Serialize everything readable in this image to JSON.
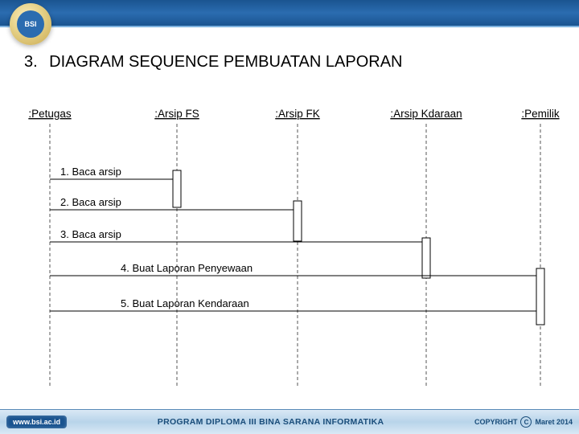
{
  "title_num": "3.",
  "title_text": "DIAGRAM SEQUENCE PEMBUATAN LAPORAN",
  "participants": {
    "p0": ":Petugas",
    "p1": ":Arsip FS",
    "p2": ":Arsip FK",
    "p3": ":Arsip Kdaraan",
    "p4": ":Pemilik"
  },
  "messages": {
    "m1": "1. Baca arsip",
    "m2": "2. Baca arsip",
    "m3": "3. Baca arsip",
    "m4": "4. Buat Laporan Penyewaan",
    "m5": "5. Buat Laporan Kendaraan"
  },
  "footer": {
    "url": "www.bsi.ac.id",
    "program": "PROGRAM DIPLOMA III BINA SARANA INFORMATIKA",
    "copyright_label": "COPYRIGHT",
    "copysymbol": "C",
    "date": "Maret 2014"
  },
  "logo_abbr": "BSI"
}
